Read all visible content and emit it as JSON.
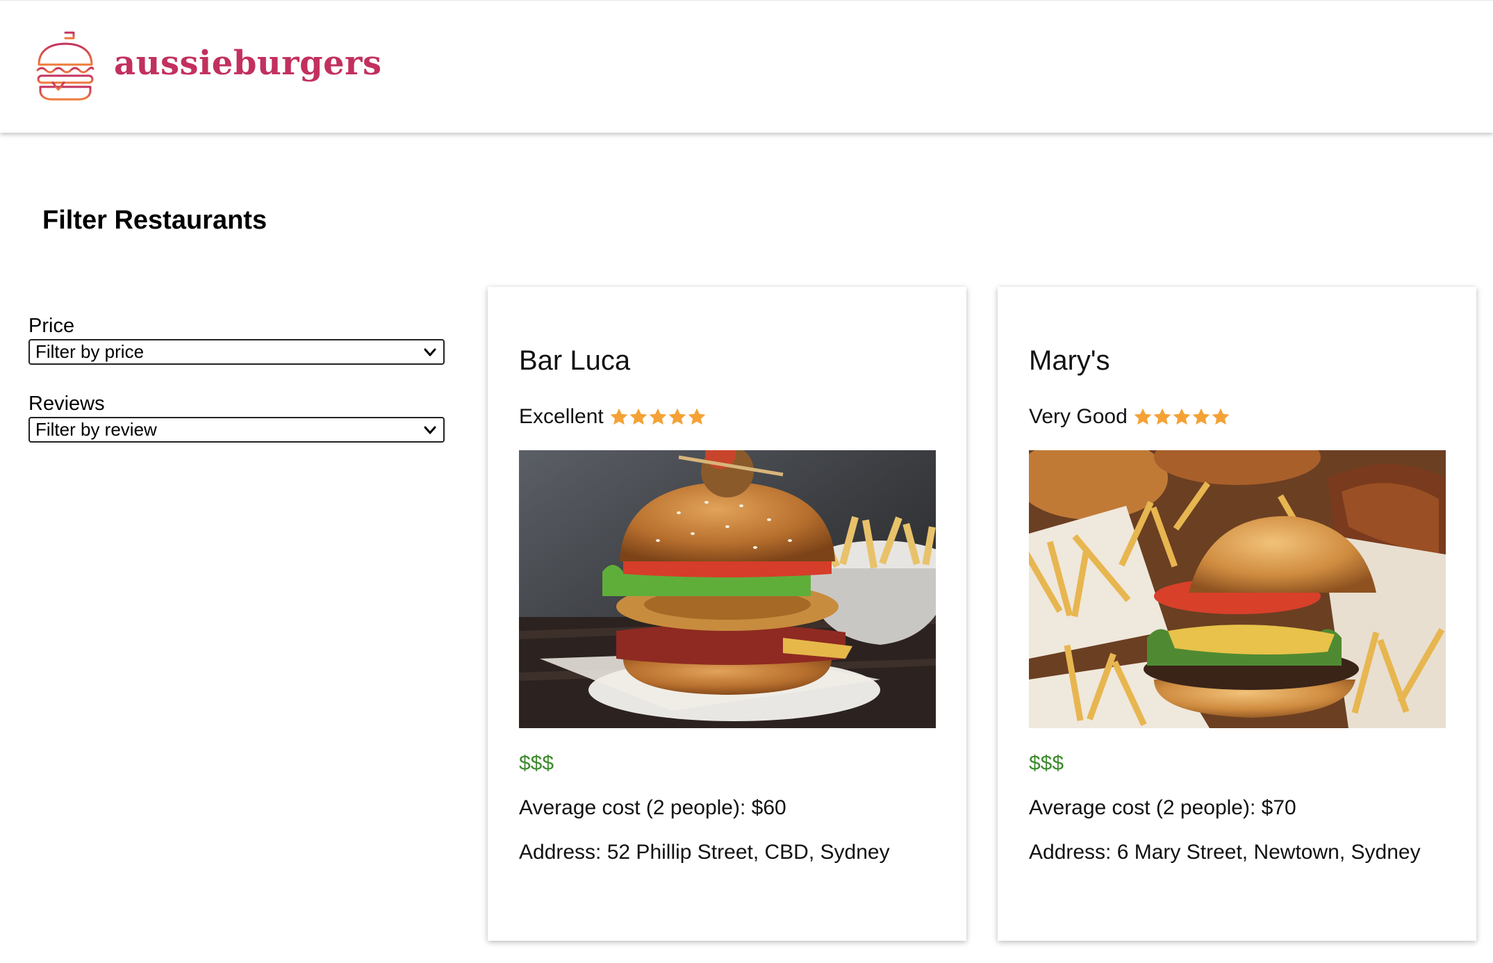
{
  "brand": {
    "name": "aussieburgers",
    "color": "#c2305e",
    "logo_icon": "burger-icon"
  },
  "page_title": "Filter Restaurants",
  "filters": {
    "price": {
      "label": "Price",
      "selected": "Filter by price"
    },
    "reviews": {
      "label": "Reviews",
      "selected": "Filter by review"
    }
  },
  "restaurants": [
    {
      "name": "Bar Luca",
      "rating_text": "Excellent",
      "stars": 5,
      "image": "burger-photo",
      "price_level": "$$$",
      "average_cost": "Average cost (2 people): $60",
      "address": "Address: 52 Phillip Street, CBD, Sydney"
    },
    {
      "name": "Mary's",
      "rating_text": "Very Good",
      "stars": 5,
      "image": "burger-and-fries-photo",
      "price_level": "$$$",
      "average_cost": "Average cost (2 people): $70",
      "address": "Address: 6 Mary Street, Newtown, Sydney"
    }
  ],
  "colors": {
    "star": "#f4a236",
    "price": "#3c8a2e"
  }
}
